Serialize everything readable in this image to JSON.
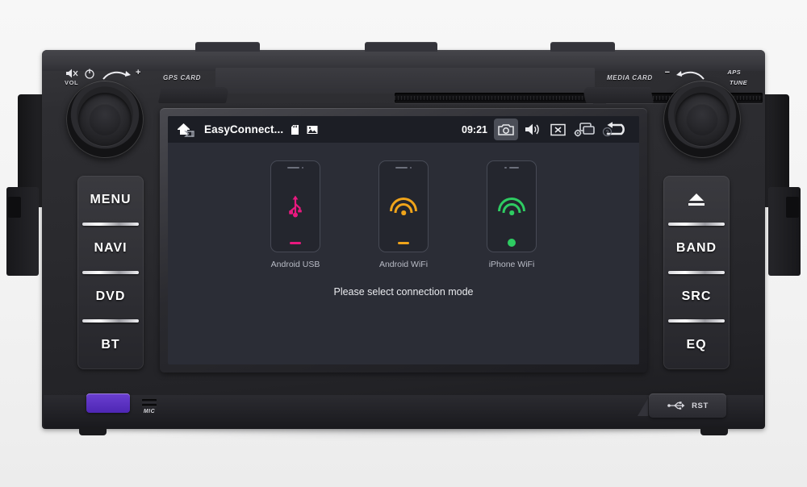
{
  "device": {
    "chassis_labels": {
      "gps_card": "GPS CARD",
      "media_card": "MEDIA CARD",
      "vol": "VOL",
      "mic": "MIC",
      "rst": "RST",
      "aps": "APS",
      "tune": "TUNE",
      "plus": "+",
      "minus": "−"
    },
    "left_buttons": [
      {
        "label": "MENU",
        "name": "menu-button"
      },
      {
        "label": "NAVI",
        "name": "navi-button"
      },
      {
        "label": "DVD",
        "name": "dvd-button"
      },
      {
        "label": "BT",
        "name": "bt-button"
      }
    ],
    "right_buttons": [
      {
        "label": "",
        "name": "eject-button",
        "icon": "eject-icon"
      },
      {
        "label": "BAND",
        "name": "band-button"
      },
      {
        "label": "SRC",
        "name": "src-button"
      },
      {
        "label": "EQ",
        "name": "eq-button"
      }
    ]
  },
  "screen": {
    "statusbar": {
      "home_icon": "home-back-icon",
      "app_title": "EasyConnect...",
      "sd_icon": "sd-card-icon",
      "gallery_icon": "image-icon",
      "time": "09:21",
      "icons": [
        {
          "name": "camera-icon",
          "active": true
        },
        {
          "name": "volume-icon",
          "active": false
        },
        {
          "name": "close-window-icon",
          "active": false
        },
        {
          "name": "settings-window-icon",
          "active": false
        },
        {
          "name": "back-return-icon",
          "active": false
        }
      ]
    },
    "cards": [
      {
        "label": "Android USB",
        "icon": "usb-icon",
        "color": "#e8197f",
        "home": "bar"
      },
      {
        "label": "Android WiFi",
        "icon": "wifi-icon",
        "color": "#f0a41a",
        "home": "bar"
      },
      {
        "label": "iPhone WiFi",
        "icon": "wifi-icon",
        "color": "#2ecc62",
        "home": "circle"
      }
    ],
    "hint": "Please select connection mode",
    "colors": {
      "status_bg": "#1c1e25",
      "screen_bg": "#2b2d36",
      "phone_bg": "#24262e",
      "label": "#b9bcc6"
    }
  }
}
